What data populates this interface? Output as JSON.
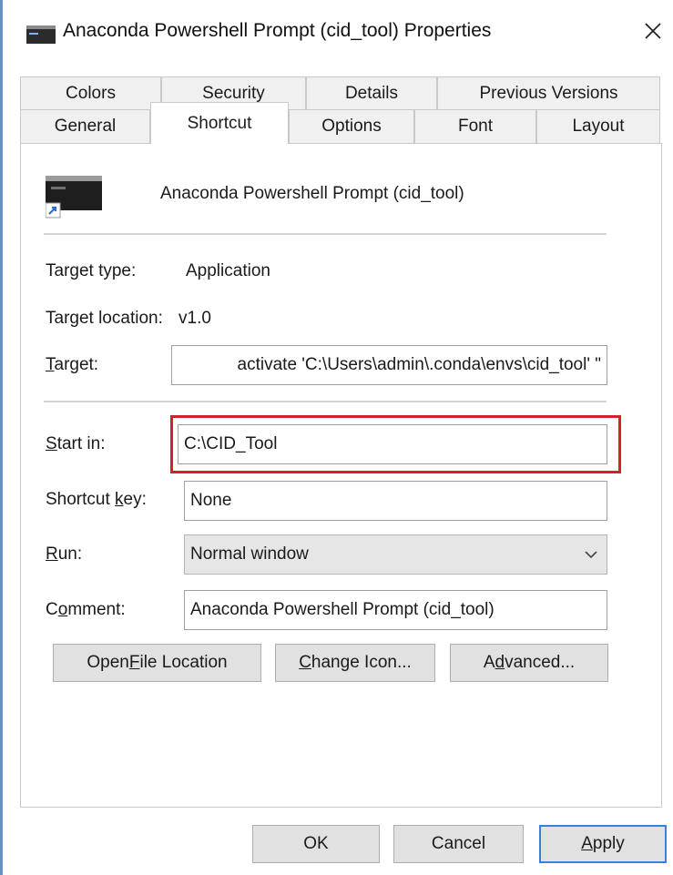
{
  "window": {
    "title": "Anaconda Powershell Prompt (cid_tool) Properties",
    "close_glyph": "✕",
    "icon": "console-app-icon"
  },
  "tabs": {
    "row1": [
      "Colors",
      "Security",
      "Details",
      "Previous Versions"
    ],
    "row2": [
      "General",
      "Shortcut",
      "Options",
      "Font",
      "Layout"
    ],
    "active": "Shortcut"
  },
  "shortcut": {
    "name": "Anaconda Powershell Prompt (cid_tool)",
    "target_type_label": "Target type:",
    "target_type_value": "Application",
    "target_location_label": "Target location:",
    "target_location_value": "v1.0",
    "target_label_pre": "",
    "target_label_key": "T",
    "target_label_post": "arget:",
    "target_value": "activate 'C:\\Users\\admin\\.conda\\envs\\cid_tool' \"",
    "start_in_label_key": "S",
    "start_in_label_post": "tart in:",
    "start_in_value": "C:\\CID_Tool",
    "shortcut_key_label_pre": "Shortcut ",
    "shortcut_key_label_key": "k",
    "shortcut_key_label_post": "ey:",
    "shortcut_key_value": "None",
    "run_label_key": "R",
    "run_label_post": "un:",
    "run_value": "Normal window",
    "comment_label_pre": "C",
    "comment_label_key": "o",
    "comment_label_post": "mment:",
    "comment_value": "Anaconda Powershell Prompt (cid_tool)"
  },
  "buttons": {
    "open_file_location_pre": "Open ",
    "open_file_location_key": "F",
    "open_file_location_post": "ile Location",
    "change_icon_key": "C",
    "change_icon_post": "hange Icon...",
    "advanced_pre": "A",
    "advanced_key": "d",
    "advanced_post": "vanced...",
    "ok": "OK",
    "cancel": "Cancel",
    "apply_key": "A",
    "apply_post": "pply"
  },
  "colors": {
    "highlight": "#d2232a",
    "default_button_border": "#3c7fd8"
  }
}
